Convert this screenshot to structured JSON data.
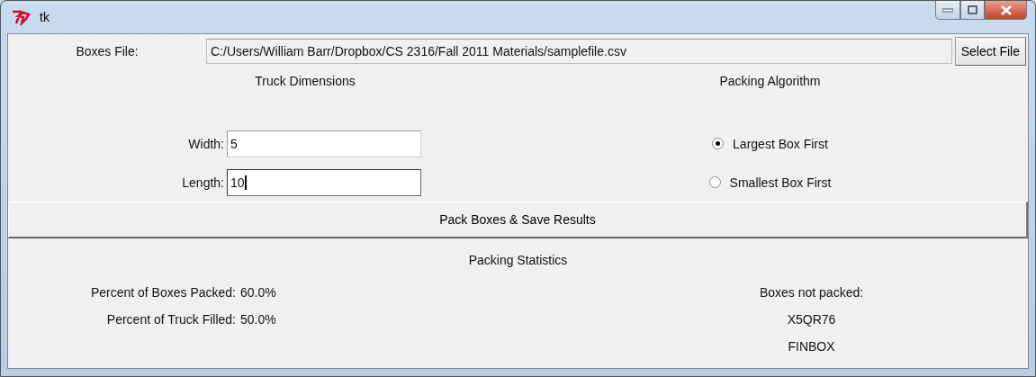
{
  "window": {
    "title": "tk"
  },
  "file_row": {
    "label": "Boxes File:",
    "value": "C:/Users/William Barr/Dropbox/CS 2316/Fall 2011 Materials/samplefile.csv",
    "button": "Select File"
  },
  "truck_dimensions": {
    "heading": "Truck Dimensions",
    "fields": [
      {
        "label": "Width:",
        "value": "5",
        "focused": false
      },
      {
        "label": "Length:",
        "value": "10",
        "focused": true
      }
    ]
  },
  "packing_algorithm": {
    "heading": "Packing Algorithm",
    "options": [
      {
        "label": "Largest Box First",
        "selected": true
      },
      {
        "label": "Smallest Box First",
        "selected": false
      }
    ]
  },
  "pack_button": "Pack Boxes & Save Results",
  "statistics": {
    "heading": "Packing Statistics",
    "rows": [
      {
        "label": "Percent of Boxes Packed:",
        "value": "60.0%"
      },
      {
        "label": "Percent of Truck Filled:",
        "value": "50.0%"
      }
    ],
    "not_packed_label": "Boxes not packed:",
    "not_packed": [
      "X5QR76",
      "FINBOX"
    ]
  }
}
